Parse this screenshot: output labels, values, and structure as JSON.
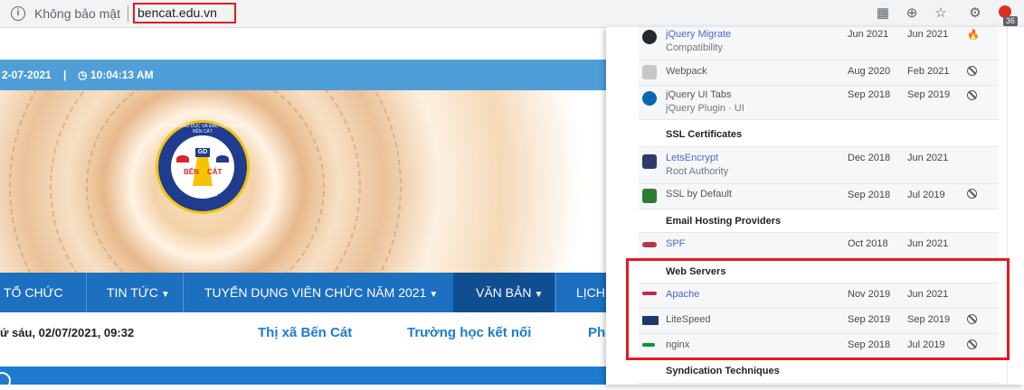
{
  "browser": {
    "security_label": "Không bảo mật",
    "url": "bencat.edu.vn",
    "extension_count": "36"
  },
  "site": {
    "date_prefix": "2-07-2021",
    "time": "10:04:13 AM",
    "nav": [
      {
        "label": "TỔ CHỨC",
        "caret": false
      },
      {
        "label": "TIN TỨC",
        "caret": true
      },
      {
        "label": "TUYỂN DỤNG VIÊN CHỨC NĂM 2021",
        "caret": true
      },
      {
        "label": "VĂN BẢN",
        "caret": true,
        "active": true
      },
      {
        "label": "LỊCH",
        "caret": false
      }
    ],
    "datetime_line": "ứ sáu, 02/07/2021, 09:32",
    "ticker": [
      "Thị xã Bến Cát",
      "Trường học kết nối",
      "Ph"
    ],
    "logo": {
      "center": "GD",
      "left": "BẾN",
      "right": "CÁT",
      "bottom": "Bình Dương",
      "arc": "PHÒNG GIÁO DỤC VÀ ĐÀO TẠO THỊ XÃ BẾN CÁT"
    }
  },
  "panel": {
    "rows": [
      {
        "name": "jQuery Migrate",
        "sub": "Compatibility",
        "first": "Jun 2021",
        "last": "Jun 2021",
        "status": "fire",
        "link": true,
        "icon": "github-icon",
        "color": "#24292e"
      },
      {
        "name": "Webpack",
        "sub": "",
        "first": "Aug 2020",
        "last": "Feb 2021",
        "status": "ban",
        "link": false,
        "icon": "webpack-icon",
        "color": "#c7c7c7"
      },
      {
        "name": "jQuery UI Tabs",
        "sub": "jQuery Plugin · UI",
        "first": "Sep 2018",
        "last": "Sep 2019",
        "status": "ban",
        "link": false,
        "icon": "jquery-icon",
        "color": "#0769ad"
      }
    ],
    "ssl": {
      "heading": "SSL Certificates",
      "rows": [
        {
          "name": "LetsEncrypt",
          "sub": "Root Authority",
          "first": "Dec 2018",
          "last": "Jun 2021",
          "status": "",
          "link": true,
          "icon": "letsencrypt-icon",
          "color": "#2c3c69"
        },
        {
          "name": "SSL by Default",
          "sub": "",
          "first": "Sep 2018",
          "last": "Jul 2019",
          "status": "ban",
          "link": false,
          "icon": "ssl-icon",
          "color": "#2e7d32"
        }
      ]
    },
    "email": {
      "heading": "Email Hosting Providers",
      "rows": [
        {
          "name": "SPF",
          "sub": "",
          "first": "Oct 2018",
          "last": "Jun 2021",
          "status": "",
          "link": true,
          "icon": "spf-icon",
          "color": "#b03a48"
        }
      ]
    },
    "web": {
      "heading": "Web Servers",
      "rows": [
        {
          "name": "Apache",
          "sub": "",
          "first": "Nov 2019",
          "last": "Jun 2021",
          "status": "",
          "link": true,
          "icon": "apache-icon",
          "color": "#c22a4d"
        },
        {
          "name": "LiteSpeed",
          "sub": "",
          "first": "Sep 2019",
          "last": "Sep 2019",
          "status": "ban",
          "link": false,
          "icon": "litespeed-icon",
          "color": "#1b3a6b"
        },
        {
          "name": "nginx",
          "sub": "",
          "first": "Sep 2018",
          "last": "Jul 2019",
          "status": "ban",
          "link": false,
          "icon": "nginx-icon",
          "color": "#009639"
        }
      ]
    },
    "syndication": {
      "heading": "Syndication Techniques"
    }
  }
}
